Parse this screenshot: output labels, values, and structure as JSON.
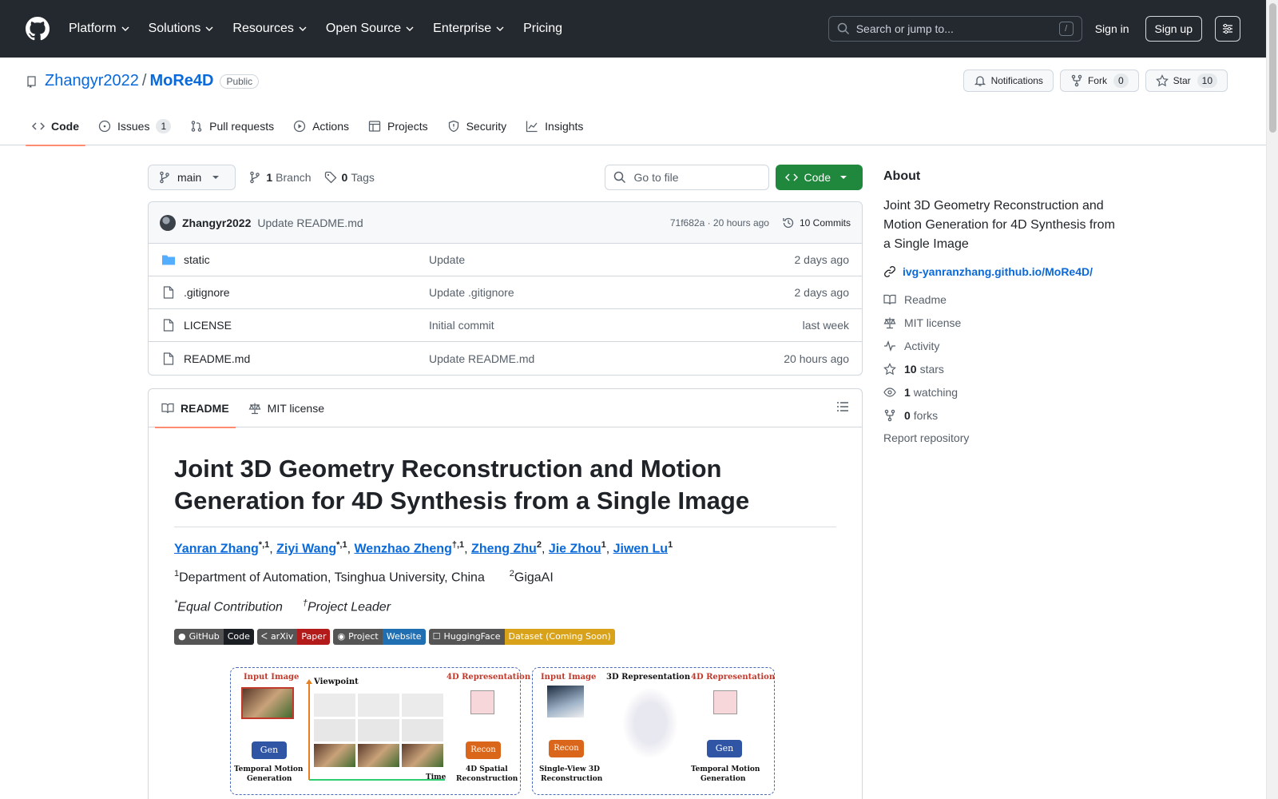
{
  "header": {
    "nav": [
      "Platform",
      "Solutions",
      "Resources",
      "Open Source",
      "Enterprise",
      "Pricing"
    ],
    "search_placeholder": "Search or jump to...",
    "search_shortcut": "/",
    "signin": "Sign in",
    "signup": "Sign up"
  },
  "repo": {
    "owner": "Zhangyr2022",
    "separator": "/",
    "name": "MoRe4D",
    "visibility": "Public",
    "notifications": "Notifications",
    "fork_label": "Fork",
    "fork_count": "0",
    "star_label": "Star",
    "star_count": "10"
  },
  "tabs": [
    {
      "label": "Code",
      "icon": "code-icon"
    },
    {
      "label": "Issues",
      "icon": "issue-icon",
      "count": "1"
    },
    {
      "label": "Pull requests",
      "icon": "pull-request-icon"
    },
    {
      "label": "Actions",
      "icon": "play-icon"
    },
    {
      "label": "Projects",
      "icon": "table-icon"
    },
    {
      "label": "Security",
      "icon": "shield-icon"
    },
    {
      "label": "Insights",
      "icon": "graph-icon"
    }
  ],
  "toolbar": {
    "branch": "main",
    "branch_count": "1",
    "branch_label": "Branch",
    "tag_count": "0",
    "tag_label": "Tags",
    "goto_placeholder": "Go to file",
    "code_button": "Code"
  },
  "latest_commit": {
    "author": "Zhangyr2022",
    "message": "Update README.md",
    "meta": "71f682a · 20 hours ago",
    "commits": "10 Commits"
  },
  "files": [
    {
      "name": "static",
      "type": "folder",
      "commit": "Update",
      "age": "2 days ago"
    },
    {
      "name": ".gitignore",
      "type": "file",
      "commit": "Update .gitignore",
      "age": "2 days ago"
    },
    {
      "name": "LICENSE",
      "type": "file",
      "commit": "Initial commit",
      "age": "last week"
    },
    {
      "name": "README.md",
      "type": "file",
      "commit": "Update README.md",
      "age": "20 hours ago"
    }
  ],
  "readme": {
    "tab_readme": "README",
    "tab_license": "MIT license",
    "title": "Joint 3D Geometry Reconstruction and Motion Generation for 4D Synthesis from a Single Image",
    "authors": [
      {
        "name": "Yanran Zhang",
        "sup": "*,1"
      },
      {
        "name": "Ziyi Wang",
        "sup": "*,1"
      },
      {
        "name": "Wenzhao Zheng",
        "sup": "†,1"
      },
      {
        "name": "Zheng Zhu",
        "sup": "2"
      },
      {
        "name": "Jie Zhou",
        "sup": "1"
      },
      {
        "name": "Jiwen Lu",
        "sup": "1"
      }
    ],
    "affil_1_sup": "1",
    "affil_1": "Department of Automation, Tsinghua University, China",
    "affil_2_sup": "2",
    "affil_2": "GigaAI",
    "note_1_sup": "*",
    "note_1": "Equal Contribution",
    "note_2_sup": "†",
    "note_2": "Project Leader",
    "badges": [
      {
        "left": "GitHub",
        "right": "Code",
        "color": "#1b1f24"
      },
      {
        "left": "arXiv",
        "right": "Paper",
        "color": "#b31b1b"
      },
      {
        "left": "Project",
        "right": "Website",
        "color": "#1f6fb2"
      },
      {
        "left": "HuggingFace",
        "right": "Dataset (Coming Soon)",
        "color": "#d9a21b"
      }
    ],
    "figure": {
      "left": {
        "input": "Input Image",
        "viewpoint": "Viewpoint",
        "rep4d": "4D Representation",
        "gen": "Gen",
        "recon": "Recon",
        "temporal": "Temporal Motion",
        "generation": "Generation",
        "time": "Time",
        "spatial": "4D Spatial",
        "reconstruction": "Reconstruction"
      },
      "right": {
        "input": "Input Image",
        "rep3d": "3D Representation",
        "rep4d": "4D Representation",
        "recon": "Recon",
        "gen": "Gen",
        "single": "Single-View 3D",
        "reconstruction": "Reconstruction",
        "temporal": "Temporal Motion",
        "generation": "Generation"
      }
    }
  },
  "about": {
    "heading": "About",
    "description": "Joint 3D Geometry Reconstruction and Motion Generation for 4D Synthesis from a Single Image",
    "link": "ivg-yanranzhang.github.io/MoRe4D/",
    "readme": "Readme",
    "license": "MIT license",
    "activity": "Activity",
    "stars_count": "10",
    "stars_label": "stars",
    "watching_count": "1",
    "watching_label": "watching",
    "forks_count": "0",
    "forks_label": "forks",
    "report": "Report repository"
  }
}
